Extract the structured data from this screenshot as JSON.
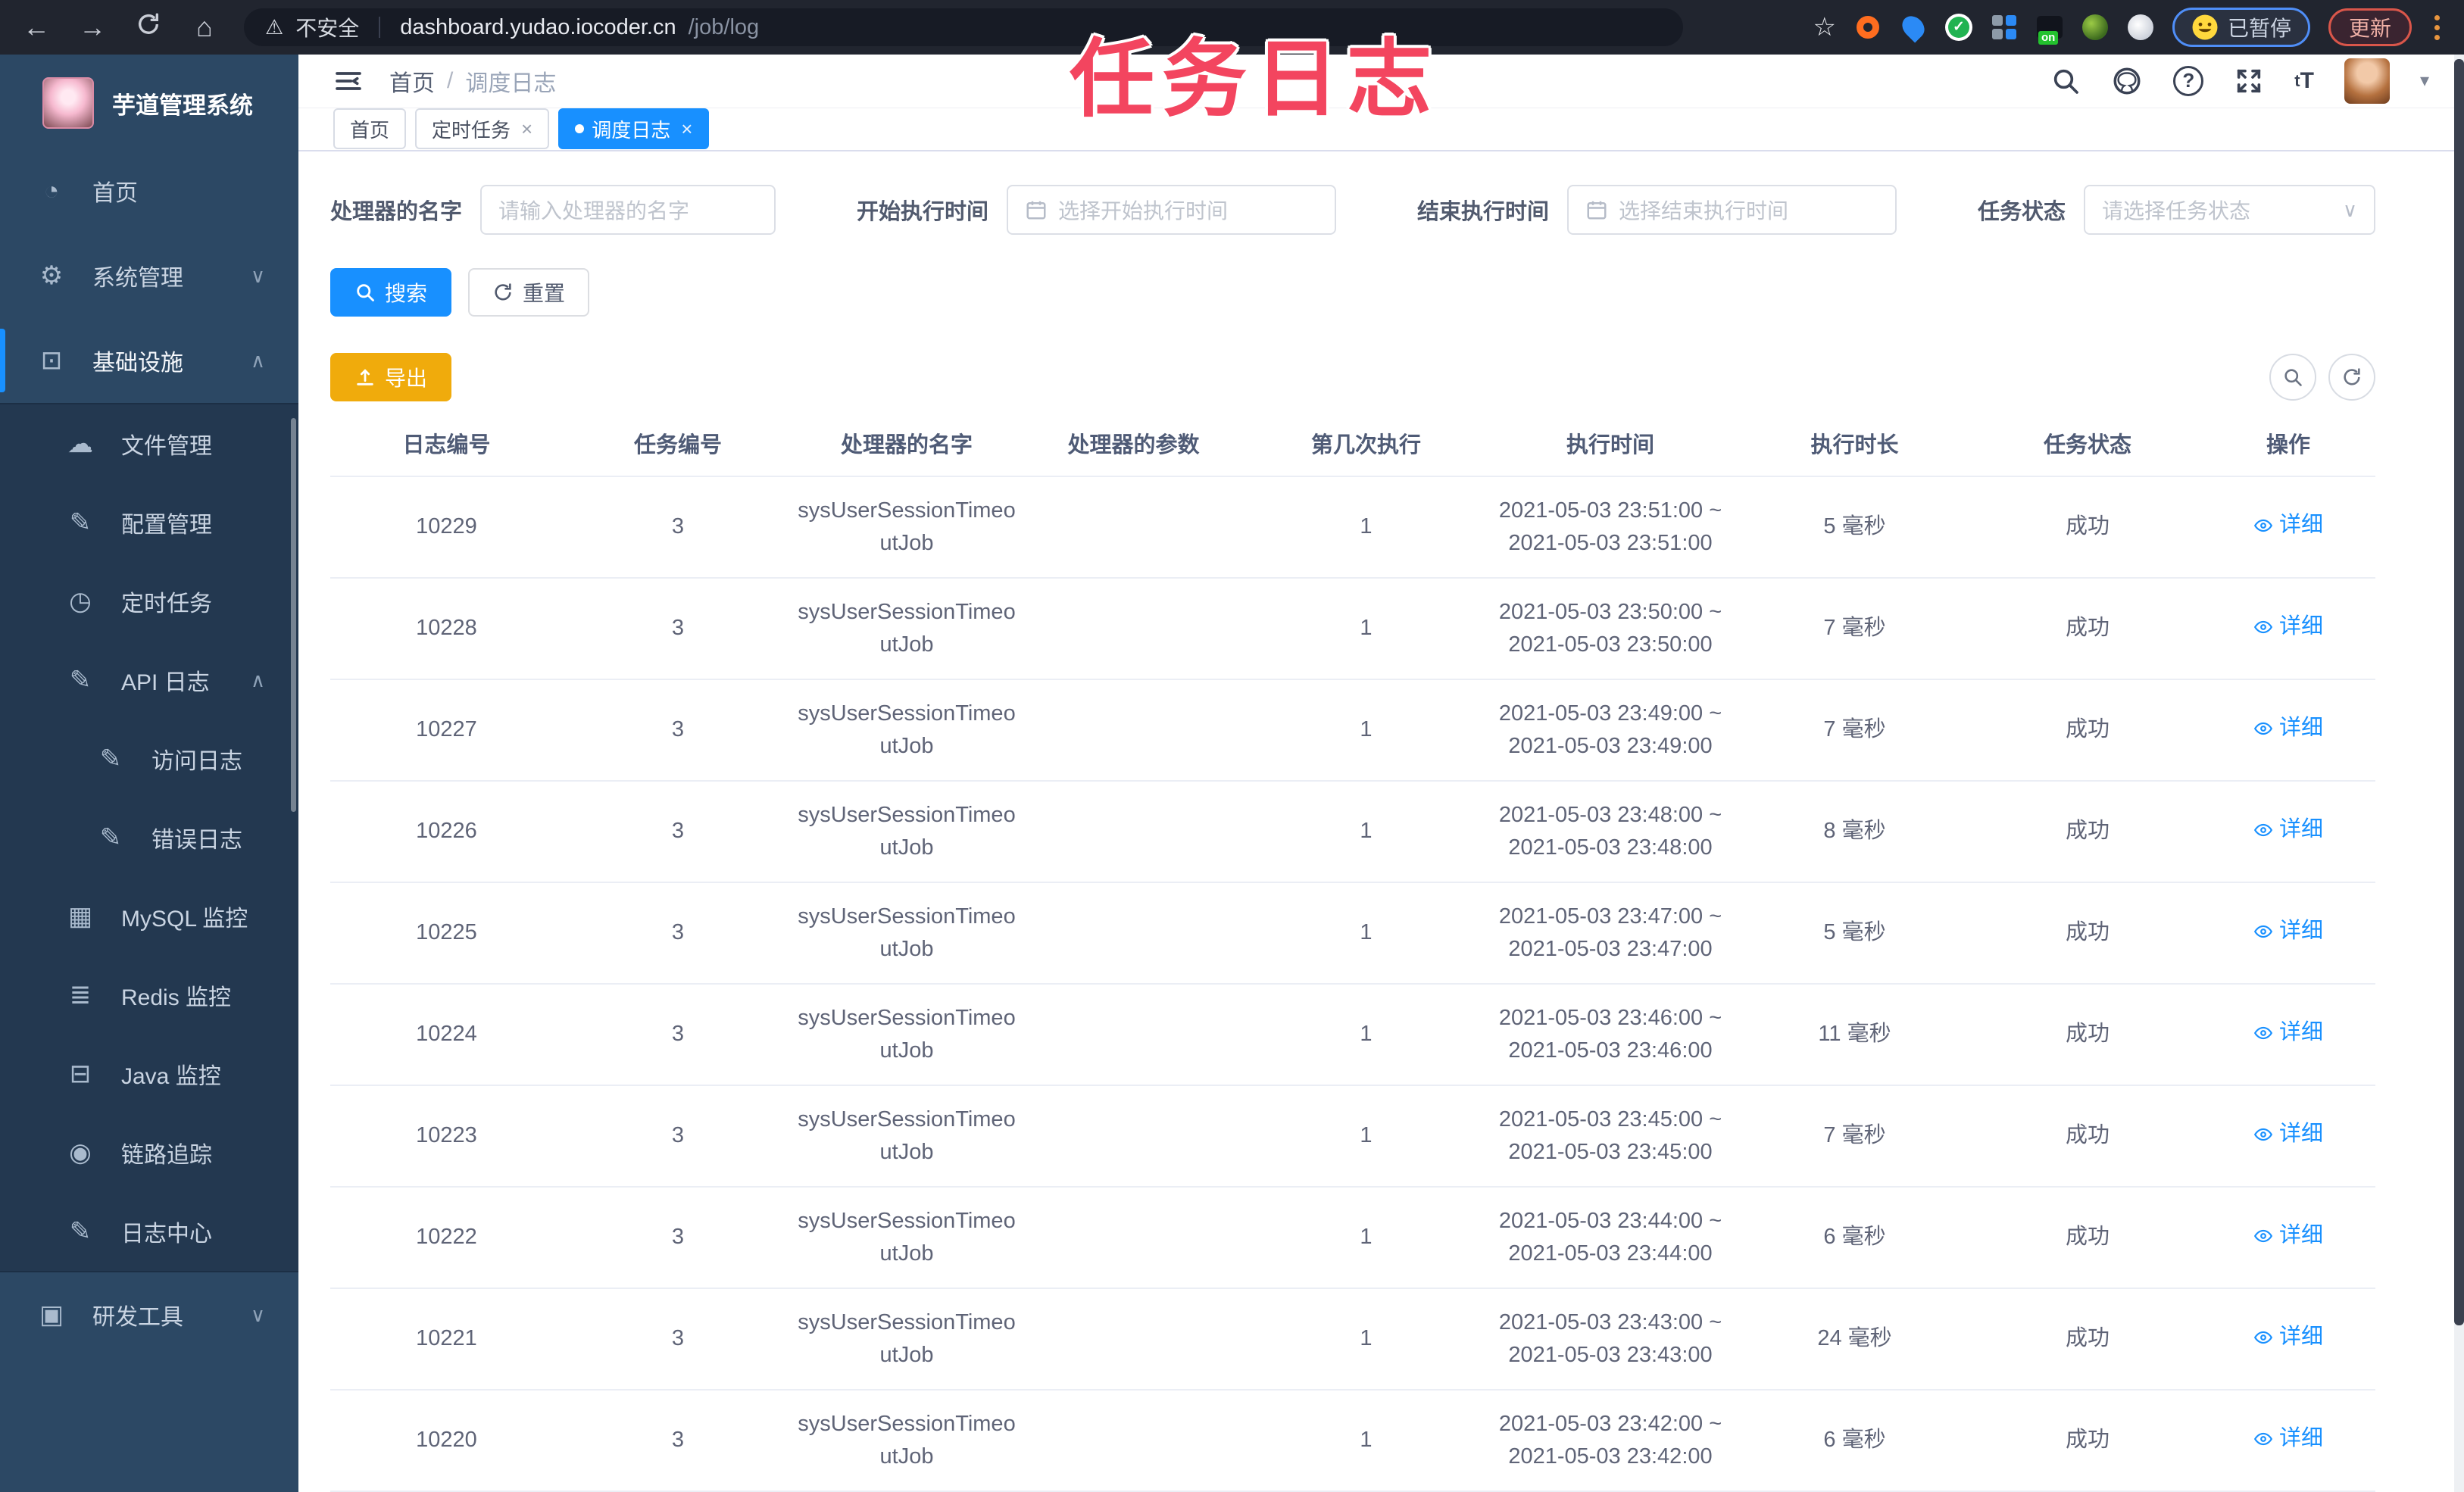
{
  "browser": {
    "security_label": "不安全",
    "url_host": "dashboard.yudao.iocoder.cn",
    "url_path": "/job/log",
    "extension_on_label": "on",
    "paused_badge": "已暂停",
    "update_button": "更新"
  },
  "annotation": {
    "text": "任务日志",
    "color": "#f3455f"
  },
  "sidebar": {
    "title": "芋道管理系统",
    "items": [
      {
        "label": "首页",
        "icon": "dashboard-icon"
      },
      {
        "label": "系统管理",
        "icon": "gear-icon",
        "state": "collapsed"
      },
      {
        "label": "基础设施",
        "icon": "monitor-check-icon",
        "state": "expanded",
        "active": true,
        "children": [
          {
            "label": "文件管理",
            "icon": "cloud-upload-icon"
          },
          {
            "label": "配置管理",
            "icon": "edit-icon"
          },
          {
            "label": "定时任务",
            "icon": "timer-icon"
          },
          {
            "label": "API 日志",
            "icon": "edit-icon",
            "state": "expanded",
            "children": [
              {
                "label": "访问日志",
                "icon": "edit-icon"
              },
              {
                "label": "错误日志",
                "icon": "edit-icon"
              }
            ]
          },
          {
            "label": "MySQL 监控",
            "icon": "chart-icon"
          },
          {
            "label": "Redis 监控",
            "icon": "layers-icon"
          },
          {
            "label": "Java 监控",
            "icon": "java-monitor-icon"
          },
          {
            "label": "链路追踪",
            "icon": "eye-icon"
          },
          {
            "label": "日志中心",
            "icon": "edit-icon"
          }
        ]
      },
      {
        "label": "研发工具",
        "icon": "toolbox-icon",
        "state": "collapsed"
      }
    ]
  },
  "topbar": {
    "breadcrumb": [
      "首页",
      "调度日志"
    ],
    "breadcrumb_separator": "/",
    "fontsize_icon_label": "tT"
  },
  "tabs": [
    {
      "label": "首页",
      "active": false,
      "closable": false
    },
    {
      "label": "定时任务",
      "active": false,
      "closable": true
    },
    {
      "label": "调度日志",
      "active": true,
      "closable": true
    }
  ],
  "filters": {
    "handler": {
      "label": "处理器的名字",
      "placeholder": "请输入处理器的名字"
    },
    "start_time": {
      "label": "开始执行时间",
      "placeholder": "选择开始执行时间"
    },
    "end_time": {
      "label": "结束执行时间",
      "placeholder": "选择结束执行时间"
    },
    "status": {
      "label": "任务状态",
      "placeholder": "请选择任务状态"
    }
  },
  "buttons": {
    "search": "搜索",
    "reset": "重置",
    "export": "导出"
  },
  "table": {
    "headers": [
      "日志编号",
      "任务编号",
      "处理器的名字",
      "处理器的参数",
      "第几次执行",
      "执行时间",
      "执行时长",
      "任务状态",
      "操作"
    ],
    "action_label": "详细",
    "rows": [
      {
        "id": "10229",
        "job": "3",
        "handler": "sysUserSessionTimeoutJob",
        "param": "",
        "times": "1",
        "start": "2021-05-03 23:51:00 ~",
        "end": "2021-05-03 23:51:00",
        "duration": "5 毫秒",
        "status": "成功"
      },
      {
        "id": "10228",
        "job": "3",
        "handler": "sysUserSessionTimeoutJob",
        "param": "",
        "times": "1",
        "start": "2021-05-03 23:50:00 ~",
        "end": "2021-05-03 23:50:00",
        "duration": "7 毫秒",
        "status": "成功"
      },
      {
        "id": "10227",
        "job": "3",
        "handler": "sysUserSessionTimeoutJob",
        "param": "",
        "times": "1",
        "start": "2021-05-03 23:49:00 ~",
        "end": "2021-05-03 23:49:00",
        "duration": "7 毫秒",
        "status": "成功"
      },
      {
        "id": "10226",
        "job": "3",
        "handler": "sysUserSessionTimeoutJob",
        "param": "",
        "times": "1",
        "start": "2021-05-03 23:48:00 ~",
        "end": "2021-05-03 23:48:00",
        "duration": "8 毫秒",
        "status": "成功"
      },
      {
        "id": "10225",
        "job": "3",
        "handler": "sysUserSessionTimeoutJob",
        "param": "",
        "times": "1",
        "start": "2021-05-03 23:47:00 ~",
        "end": "2021-05-03 23:47:00",
        "duration": "5 毫秒",
        "status": "成功"
      },
      {
        "id": "10224",
        "job": "3",
        "handler": "sysUserSessionTimeoutJob",
        "param": "",
        "times": "1",
        "start": "2021-05-03 23:46:00 ~",
        "end": "2021-05-03 23:46:00",
        "duration": "11 毫秒",
        "status": "成功"
      },
      {
        "id": "10223",
        "job": "3",
        "handler": "sysUserSessionTimeoutJob",
        "param": "",
        "times": "1",
        "start": "2021-05-03 23:45:00 ~",
        "end": "2021-05-03 23:45:00",
        "duration": "7 毫秒",
        "status": "成功"
      },
      {
        "id": "10222",
        "job": "3",
        "handler": "sysUserSessionTimeoutJob",
        "param": "",
        "times": "1",
        "start": "2021-05-03 23:44:00 ~",
        "end": "2021-05-03 23:44:00",
        "duration": "6 毫秒",
        "status": "成功"
      },
      {
        "id": "10221",
        "job": "3",
        "handler": "sysUserSessionTimeoutJob",
        "param": "",
        "times": "1",
        "start": "2021-05-03 23:43:00 ~",
        "end": "2021-05-03 23:43:00",
        "duration": "24 毫秒",
        "status": "成功"
      },
      {
        "id": "10220",
        "job": "3",
        "handler": "sysUserSessionTimeoutJob",
        "param": "",
        "times": "1",
        "start": "2021-05-03 23:42:00 ~",
        "end": "2021-05-03 23:42:00",
        "duration": "6 毫秒",
        "status": "成功"
      }
    ]
  },
  "colors": {
    "accent": "#1890ff",
    "warning": "#f0ab0c",
    "sidebar_bg": "#2c4864",
    "sidebar_sub_bg": "#233850",
    "annotation": "#f3455f"
  }
}
